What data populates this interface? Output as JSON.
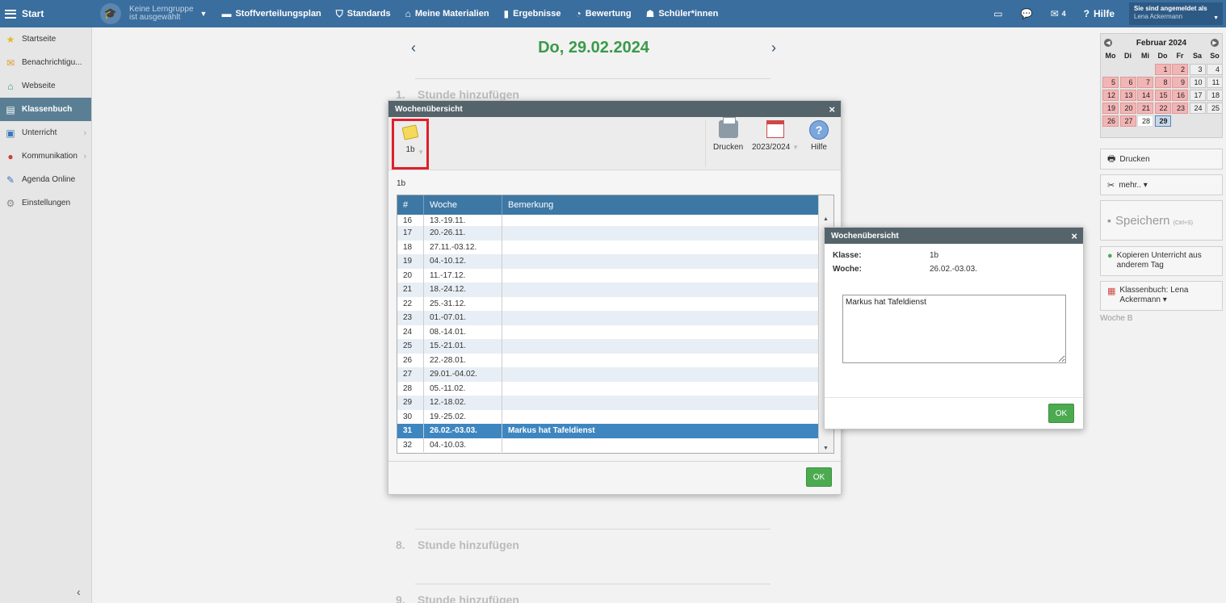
{
  "topbar": {
    "start_label": "Start",
    "group_line1": "Keine Lerngruppe",
    "group_line2": "ist ausgewählt",
    "nav": [
      {
        "label": "Stoffverteilungsplan",
        "icon": "briefcase-icon"
      },
      {
        "label": "Standards",
        "icon": "shield-icon"
      },
      {
        "label": "Meine Materialien",
        "icon": "library-icon"
      },
      {
        "label": "Ergebnisse",
        "icon": "bar-chart-icon"
      },
      {
        "label": "Bewertung",
        "icon": "gauge-icon"
      },
      {
        "label": "Schüler*innen",
        "icon": "students-icon"
      }
    ],
    "mail_count": "4",
    "help_label": "Hilfe",
    "user_label": "Sie sind angemeldet als",
    "user_name": "Lena Ackermann"
  },
  "sidebar": {
    "items": [
      {
        "label": "Startseite",
        "icon": "star-icon"
      },
      {
        "label": "Benachrichtigu...",
        "icon": "envelope-icon"
      },
      {
        "label": "Webseite",
        "icon": "home-icon"
      },
      {
        "label": "Klassenbuch",
        "icon": "book-icon"
      },
      {
        "label": "Unterricht",
        "icon": "classroom-icon"
      },
      {
        "label": "Kommunikation",
        "icon": "chat-icon"
      },
      {
        "label": "Agenda Online",
        "icon": "pen-icon"
      },
      {
        "label": "Einstellungen",
        "icon": "gear-icon"
      }
    ]
  },
  "main": {
    "date": "Do, 29.02.2024",
    "slots": [
      {
        "num": "1.",
        "label": "Stunde hinzufügen"
      },
      {
        "num": "8.",
        "label": "Stunde hinzufügen"
      },
      {
        "num": "9.",
        "label": "Stunde hinzufügen"
      }
    ]
  },
  "week_dialog": {
    "title": "Wochenübersicht",
    "class_button": "1b",
    "print_label": "Drucken",
    "year_label": "2023/2024",
    "help_label": "Hilfe",
    "class_label": "1b",
    "columns": [
      "#",
      "Woche",
      "Bemerkung"
    ],
    "rows": [
      {
        "num": "16",
        "week": "13.-19.11.",
        "note": ""
      },
      {
        "num": "17",
        "week": "20.-26.11.",
        "note": ""
      },
      {
        "num": "18",
        "week": "27.11.-03.12.",
        "note": ""
      },
      {
        "num": "19",
        "week": "04.-10.12.",
        "note": ""
      },
      {
        "num": "20",
        "week": "11.-17.12.",
        "note": ""
      },
      {
        "num": "21",
        "week": "18.-24.12.",
        "note": ""
      },
      {
        "num": "22",
        "week": "25.-31.12.",
        "note": ""
      },
      {
        "num": "23",
        "week": "01.-07.01.",
        "note": ""
      },
      {
        "num": "24",
        "week": "08.-14.01.",
        "note": ""
      },
      {
        "num": "25",
        "week": "15.-21.01.",
        "note": ""
      },
      {
        "num": "26",
        "week": "22.-28.01.",
        "note": ""
      },
      {
        "num": "27",
        "week": "29.01.-04.02.",
        "note": ""
      },
      {
        "num": "28",
        "week": "05.-11.02.",
        "note": ""
      },
      {
        "num": "29",
        "week": "12.-18.02.",
        "note": ""
      },
      {
        "num": "30",
        "week": "19.-25.02.",
        "note": ""
      },
      {
        "num": "31",
        "week": "26.02.-03.03.",
        "note": "Markus hat Tafeldienst",
        "selected": true
      },
      {
        "num": "32",
        "week": "04.-10.03.",
        "note": ""
      }
    ],
    "ok_label": "OK"
  },
  "note_dialog": {
    "title": "Wochenübersicht",
    "class_key": "Klasse:",
    "class_value": "1b",
    "week_key": "Woche:",
    "week_value": "26.02.-03.03.",
    "note_text": "Markus hat Tafeldienst",
    "ok_label": "OK"
  },
  "right_panel": {
    "cal_month": "Februar 2024",
    "dow": [
      "Mo",
      "Di",
      "Mi",
      "Do",
      "Fr",
      "Sa",
      "So"
    ],
    "print_label": "Drucken",
    "more_label": "mehr.. ▾",
    "save_label": "Speichern",
    "save_hint": "(Ctrl+S)",
    "copy_label": "Kopieren Unterricht aus anderem Tag",
    "classbook_label": "Klassenbuch: Lena Ackermann ▾",
    "week_label": "Woche B"
  }
}
